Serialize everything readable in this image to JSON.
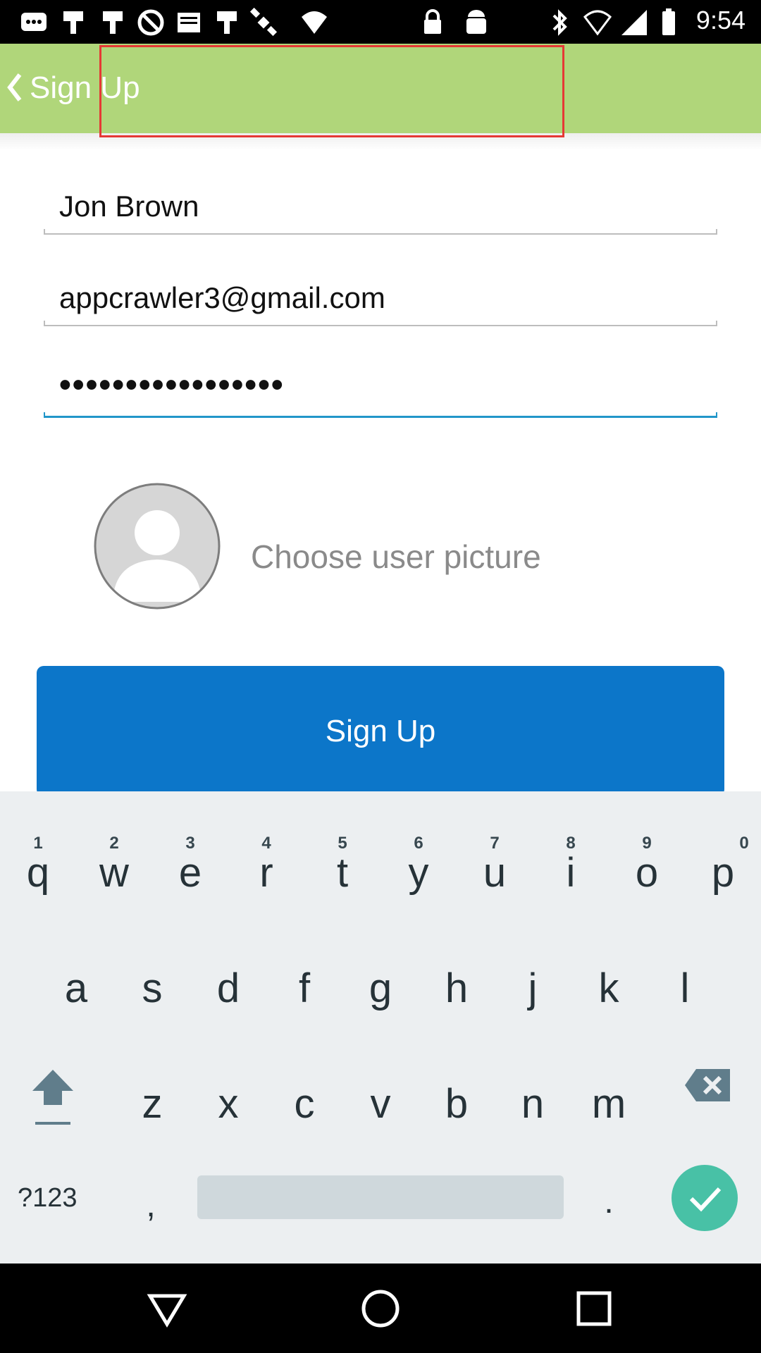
{
  "status_bar": {
    "time": "9:54",
    "icons": [
      "message-icon",
      "notification-icon",
      "notification-icon",
      "blocked-icon",
      "list-icon",
      "notification-icon",
      "satellite-icon",
      "lock-icon",
      "android-icon",
      "bluetooth-icon",
      "network-blocked-icon",
      "signal-icon",
      "battery-icon"
    ]
  },
  "app_bar": {
    "title": "Sign Up",
    "back_icon": "chevron-left-icon",
    "color": "#b0d67a"
  },
  "form": {
    "name_value": "Jon Brown",
    "email_value": "appcrawler3@gmail.com",
    "password_value": "•••••••••••••••••",
    "choose_picture_label": "Choose user picture",
    "submit_label": "Sign Up",
    "submit_color": "#0c76c9",
    "focus_color": "#2196c9"
  },
  "keyboard": {
    "row1": [
      {
        "key": "q",
        "hint": "1"
      },
      {
        "key": "w",
        "hint": "2"
      },
      {
        "key": "e",
        "hint": "3"
      },
      {
        "key": "r",
        "hint": "4"
      },
      {
        "key": "t",
        "hint": "5"
      },
      {
        "key": "y",
        "hint": "6"
      },
      {
        "key": "u",
        "hint": "7"
      },
      {
        "key": "i",
        "hint": "8"
      },
      {
        "key": "o",
        "hint": "9"
      },
      {
        "key": "p",
        "hint": "0"
      }
    ],
    "row2": [
      "a",
      "s",
      "d",
      "f",
      "g",
      "h",
      "j",
      "k",
      "l"
    ],
    "row3": [
      "z",
      "x",
      "c",
      "v",
      "b",
      "n",
      "m"
    ],
    "symbols_label": "?123",
    "comma_label": ",",
    "period_label": ".",
    "done_color": "#48c1a6"
  },
  "nav_bar": {
    "buttons": [
      "back-triangle-icon",
      "home-circle-icon",
      "recents-square-icon"
    ]
  }
}
